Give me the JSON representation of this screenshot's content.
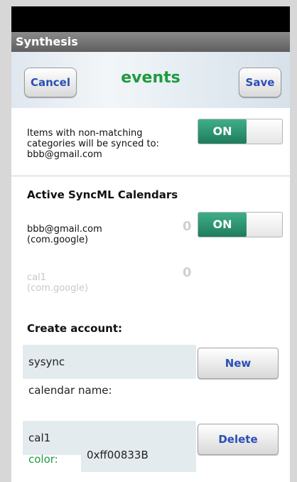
{
  "app": {
    "title": "Synthesis"
  },
  "header": {
    "cancel_label": "Cancel",
    "title": "events",
    "save_label": "Save"
  },
  "non_matching": {
    "text_line1": "Items with non-matching",
    "text_line2": "categories will be synced to:",
    "text_line3": "bbb@gmail.com",
    "toggle_label": "ON"
  },
  "calendars": {
    "heading": "Active SyncML Calendars",
    "items": [
      {
        "name": "bbb@gmail.com",
        "provider": "(com.google)",
        "count": "0",
        "toggle_label": "ON"
      },
      {
        "name": "cal1",
        "provider": "(com.google)",
        "count": "0"
      }
    ]
  },
  "create_account": {
    "heading": "Create account:",
    "account_value": "sysync",
    "new_label": "New",
    "calendar_name_label": "calendar name:",
    "calendar_name_value": "cal1",
    "delete_label": "Delete",
    "color_label": "color:",
    "color_value": "0xff00833B"
  },
  "colors": {
    "accent_green": "#1f9a3f",
    "button_text": "#2a4fb6",
    "toggle_on": "#2b8f6e"
  }
}
